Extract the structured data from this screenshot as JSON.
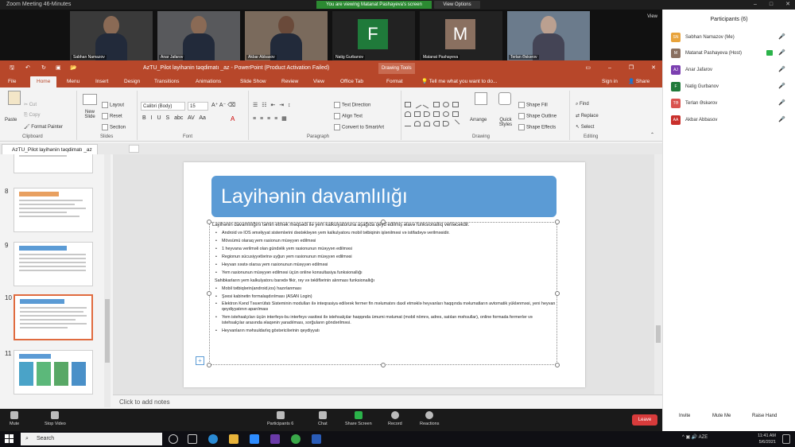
{
  "zoom": {
    "window_title": "Zoom Meeting 46-Minutes",
    "banner": "You are viewing Matanat Pashayeva's screen",
    "view_options": "View Options",
    "view_label": "View",
    "tiles": [
      {
        "name": "Sabhan Namazov",
        "type": "video"
      },
      {
        "name": "Anar Jafarov",
        "type": "video"
      },
      {
        "name": "Akbar Abbasov",
        "type": "video"
      },
      {
        "name": "Natig Gurbanov",
        "type": "letter",
        "letter": "F",
        "color": "#1f7a3a"
      },
      {
        "name": "Matanat Pashayeva",
        "type": "letter",
        "letter": "M",
        "color": "#8a7060"
      },
      {
        "name": "Terlan Əskərov",
        "type": "video"
      }
    ],
    "toolbar": {
      "mute": "Mute",
      "stop_video": "Stop Video",
      "participants": "Participants",
      "participants_count": "6",
      "chat": "Chat",
      "share_screen": "Share Screen",
      "record": "Record",
      "reactions": "Reactions",
      "leave": "Leave"
    }
  },
  "participants": {
    "header": "Participants (6)",
    "list": [
      {
        "initials": "SN",
        "name": "Səbhan Namazov (Me)",
        "color": "#e8a33b"
      },
      {
        "initials": "M",
        "name": "Matanat Pashayeva (Host)",
        "color": "#8a7060"
      },
      {
        "initials": "AJ",
        "name": "Anar Jafarov",
        "color": "#7b3fb0"
      },
      {
        "initials": "F",
        "name": "Natig Gurbanov",
        "color": "#1f7a3a"
      },
      {
        "initials": "TƏ",
        "name": "Terlan Əskərov",
        "color": "#d9534f"
      },
      {
        "initials": "AA",
        "name": "Akbar Abbasov",
        "color": "#c9302c"
      }
    ],
    "buttons": {
      "invite": "Invite",
      "mute_me": "Mute Me",
      "raise_hand": "Raise Hand"
    }
  },
  "ppt": {
    "title": "AzTU_Pilot layihənin təqdimatı _az - PowerPoint (Product Activation Failed)",
    "drawing_tools": "Drawing Tools",
    "tabs": [
      "File",
      "Home",
      "Menu",
      "Insert",
      "Design",
      "Transitions",
      "Animations",
      "Slide Show",
      "Review",
      "View",
      "Office Tab",
      "Format"
    ],
    "tell_me": "Tell me what you want to do...",
    "sign_in": "Sign in",
    "share": "Share",
    "ribbon": {
      "paste": "Paste",
      "cut": "Cut",
      "copy": "Copy",
      "format_painter": "Format Painter",
      "clipboard": "Clipboard",
      "new_slide": "New Slide",
      "layout": "Layout",
      "reset": "Reset",
      "section": "Section",
      "slides": "Slides",
      "font_name": "Calibri (Body)",
      "font_size": "15",
      "font": "Font",
      "text_direction": "Text Direction",
      "align_text": "Align Text",
      "convert_smartart": "Convert to SmartArt",
      "paragraph": "Paragraph",
      "arrange": "Arrange",
      "quick_styles": "Quick Styles",
      "shape_fill": "Shape Fill",
      "shape_outline": "Shape Outline",
      "shape_effects": "Shape Effects",
      "drawing": "Drawing",
      "find": "Find",
      "replace": "Replace",
      "select": "Select",
      "editing": "Editing"
    },
    "doc_tab": "AzTU_Pilot layihənin təqdimatı _az",
    "thumbnails": [
      {
        "num": "8"
      },
      {
        "num": "9"
      },
      {
        "num": "10"
      },
      {
        "num": "11"
      }
    ],
    "notes": "Click to add notes",
    "slide": {
      "title": "Layihənin davamlılığı",
      "intro": "Layihənin davamlılığını təmin etmək məqsədi ilə yem kalkulyatoruna aşağıda qeyd edilmiş əlavə funksionallıq veriləcəkdir.",
      "bullets": [
        "Android və IOS əməliyyat sistemlərini dəstəkləyən yem kalkulyatoru mobil tətbiqinin işlənilməsi və istifadəyə verilməsidir.",
        "Mövsümü olaraq yem rasionun müəyyən edilməsi",
        "1 heyvana verilməli olan gündəlik yem rasionunun müəyyən edilməsi",
        "Regionun sücusiyyətlərinə uyğun yem rasionunun müəyyən edilməsi",
        "Heyvan xəstə olarsa yem rasionunun müəyyən edilməsi",
        "Yem rasionunun müəyyən edilməsi üçün online konsultasiya funksionallığı",
        "Sahibkarların yem kalkulyatoru barədə fikir, rəy və təkliflərinin alınması funksionallığı",
        "Mobil tətbiqlərin(android,ios) hazırlanması",
        "Şəxsi kabinetin formalaşdırılması (ASAN Login)",
        "Elektron Kənd Təsərrüfatı Sisteminin modulları ilə inteqrasiya edilərək fermer fin məlumatını daxil etməklə heyvanları haqqında məlumatların avtomatik yüklənməsi, yeni heyvan qeydiyyatının aparılması",
        "Yem istehsalçıları üçün interfeys-bu interfeys vasitəsi ilə istehsalçılar haqqında ümumi məlumat (mobil nömrə, adres, satılan məhsullar), online formada fermerlər və istehsalçılar arasında əlaqənin yaradılması, sorğuların göndərilməsi.",
        "Heyvanların məhsuldarlıq göstəricilərinin qeydiyyatı"
      ]
    }
  },
  "taskbar": {
    "search": "Search",
    "time": "11:41 AM",
    "date": "5/6/2021",
    "lang": "AZE"
  }
}
